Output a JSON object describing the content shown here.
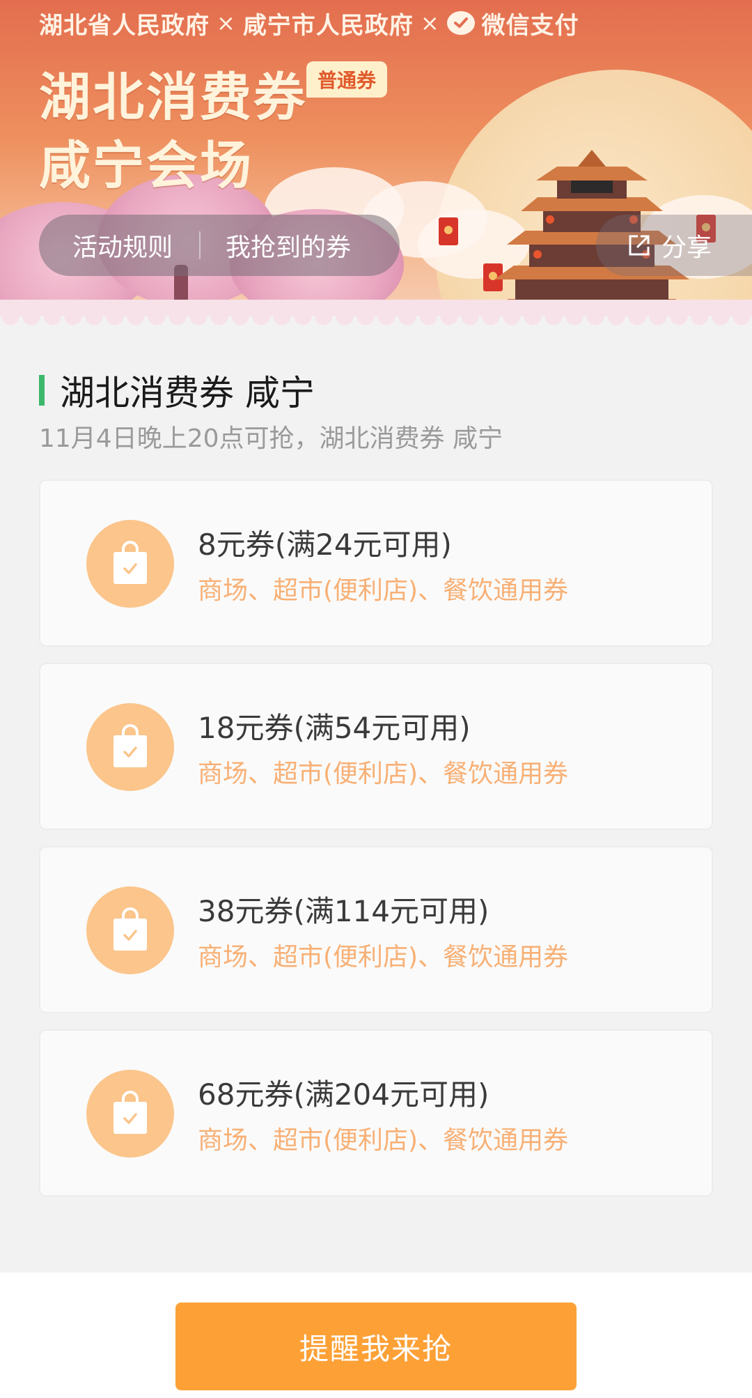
{
  "banner": {
    "partners": [
      "湖北省人民政府",
      "咸宁市人民政府",
      "微信支付"
    ],
    "separator": "×",
    "title": "湖北消费券",
    "badge": "普通券",
    "subtitle": "咸宁会场",
    "nav": {
      "rules": "活动规则",
      "my_coupons": "我抢到的券",
      "share": "分享"
    }
  },
  "section": {
    "title": "湖北消费券 咸宁",
    "subtitle": "11月4日晚上20点可抢，湖北消费券 咸宁"
  },
  "coupons": [
    {
      "title": "8元券(满24元可用)",
      "desc": "商场、超市(便利店)、餐饮通用券"
    },
    {
      "title": "18元券(满54元可用)",
      "desc": "商场、超市(便利店)、餐饮通用券"
    },
    {
      "title": "38元券(满114元可用)",
      "desc": "商场、超市(便利店)、餐饮通用券"
    },
    {
      "title": "68元券(满204元可用)",
      "desc": "商场、超市(便利店)、餐饮通用券"
    }
  ],
  "footer": {
    "cta": "提醒我来抢"
  },
  "colors": {
    "accent": "#fda137",
    "coupon_icon_bg": "#fbc58b",
    "coupon_desc": "#f8b075",
    "section_bar": "#3cb86a"
  },
  "icons": {
    "coupon": "shopping-bag-check-icon",
    "share": "share-external-icon",
    "wechat": "wechat-pay-icon"
  }
}
